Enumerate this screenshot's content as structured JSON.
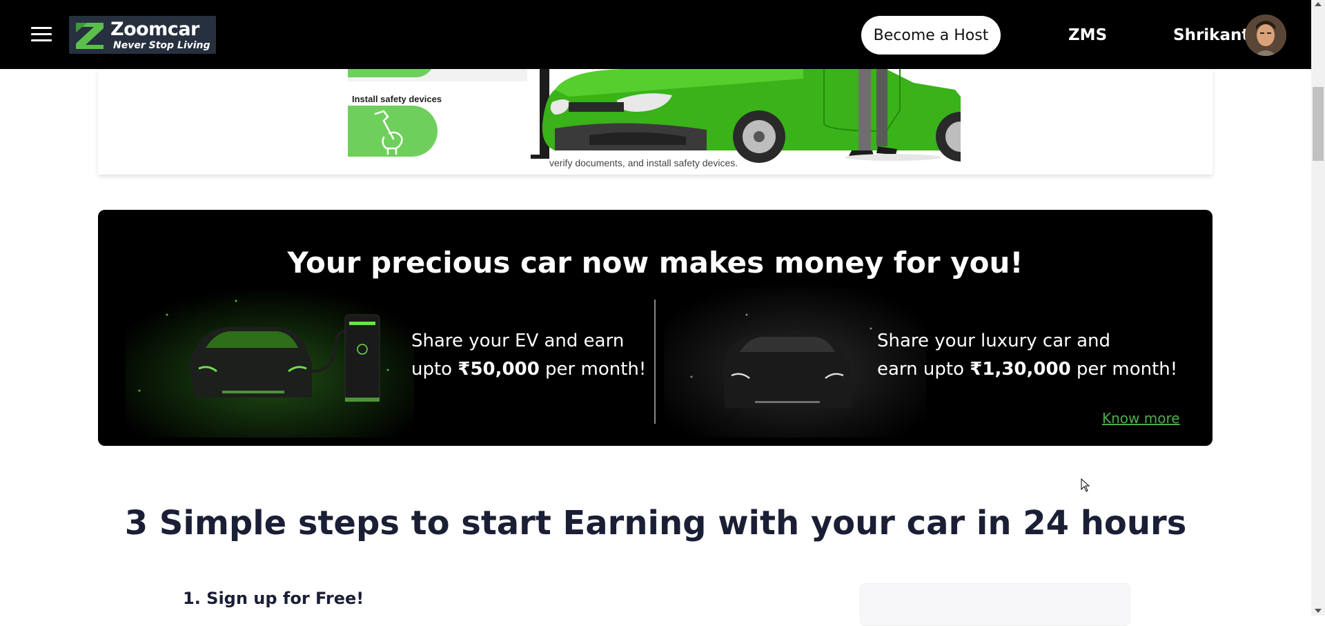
{
  "navbar": {
    "brand": "Zoomcar",
    "tagline": "Never Stop Living",
    "become_host": "Become a Host",
    "zms": "ZMS",
    "user_name": "Shrikant",
    "menu_icon": "hamburger-icon"
  },
  "illustration": {
    "install_label": "Install safety devices",
    "caption": "verify documents, and install safety devices."
  },
  "banner": {
    "title": "Your precious car now makes money for you!",
    "ev_line1": "Share your EV and earn",
    "ev_line2_prefix": "upto ",
    "ev_amount": "₹50,000",
    "ev_line2_suffix": " per month!",
    "lux_line1": "Share your luxury car and",
    "lux_line2_prefix": "earn upto ",
    "lux_amount": "₹1,30,000",
    "lux_line2_suffix": " per month!",
    "know_more": "Know more"
  },
  "steps": {
    "heading": "3 Simple steps to start Earning with your car in 24 hours",
    "step1": "1. Sign up for Free!"
  },
  "colors": {
    "navbar_bg": "#000000",
    "accent_green": "#4cae4c",
    "illustration_green": "#6fcf5c",
    "heading_text": "#1a1f36"
  }
}
